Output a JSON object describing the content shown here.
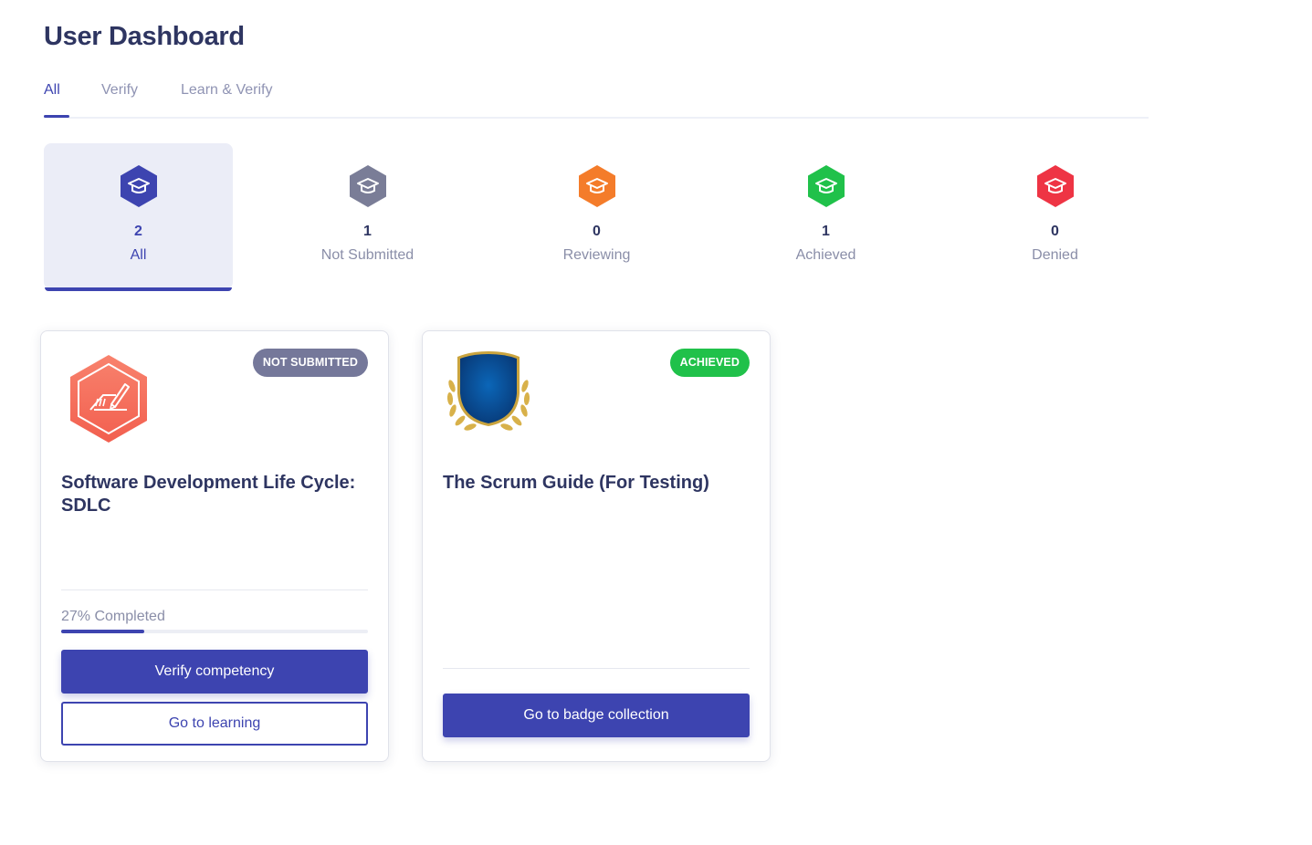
{
  "page": {
    "title": "User Dashboard"
  },
  "tabs": [
    {
      "label": "All",
      "active": true
    },
    {
      "label": "Verify",
      "active": false
    },
    {
      "label": "Learn & Verify",
      "active": false
    }
  ],
  "stats": [
    {
      "count": "2",
      "label": "All",
      "color": "#3d44b0",
      "icon": "graduation-cap-icon",
      "active": true
    },
    {
      "count": "1",
      "label": "Not Submitted",
      "color": "#7a7d97",
      "icon": "graduation-cap-icon",
      "active": false
    },
    {
      "count": "0",
      "label": "Reviewing",
      "color": "#f47c2a",
      "icon": "graduation-cap-icon",
      "active": false
    },
    {
      "count": "1",
      "label": "Achieved",
      "color": "#20c14a",
      "icon": "graduation-cap-icon",
      "active": false
    },
    {
      "count": "0",
      "label": "Denied",
      "color": "#ee3444",
      "icon": "graduation-cap-icon",
      "active": false
    }
  ],
  "cards": [
    {
      "status": "NOT SUBMITTED",
      "status_color": "#75789a",
      "icon": "writing-hand-hexagon-icon",
      "title": "Software Development Life Cycle: SDLC",
      "progress": 27,
      "progress_text": "27% Completed",
      "primary_button": "Verify competency",
      "secondary_button": "Go to learning"
    },
    {
      "status": "ACHIEVED",
      "status_color": "#20c14a",
      "icon": "shield-laurel-icon",
      "title": "The Scrum Guide (For Testing)",
      "primary_button": "Go to badge collection"
    }
  ],
  "colors": {
    "accent": "#3d44b0",
    "title": "#2e3561",
    "muted": "#8a8ea8"
  }
}
